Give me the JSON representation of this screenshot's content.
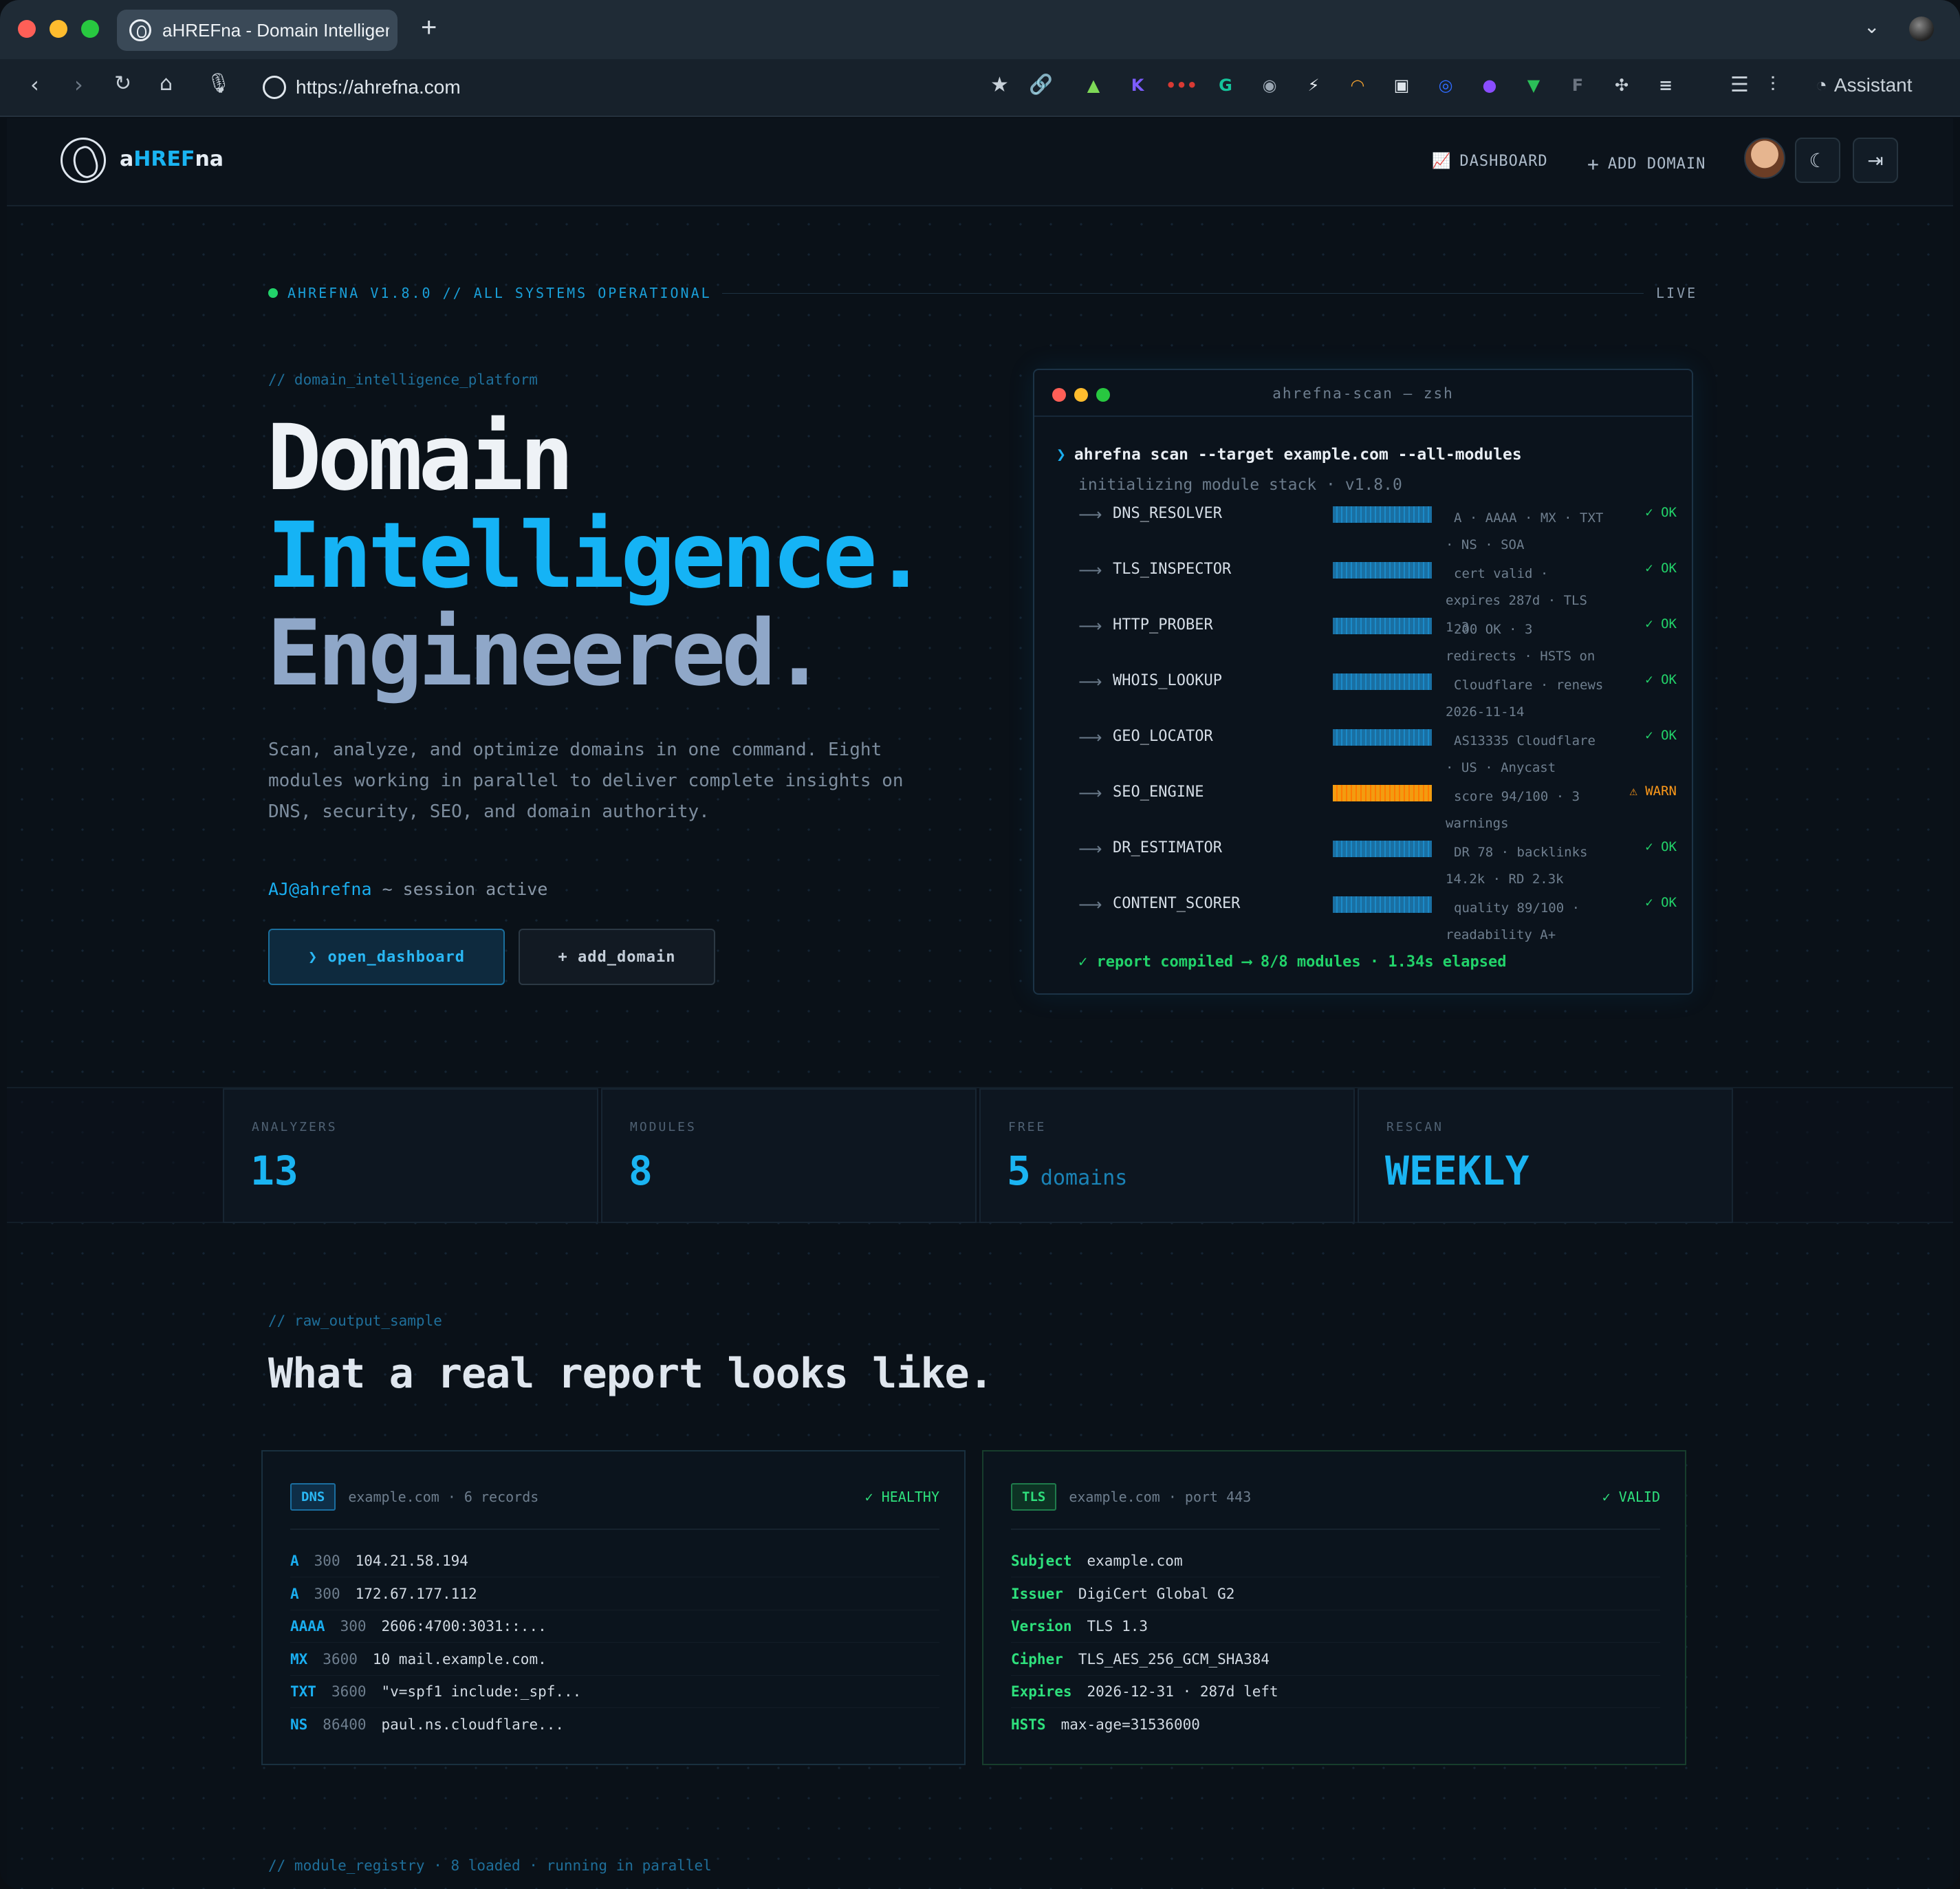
{
  "browser": {
    "tab_title": "aHREFna - Domain Intelligence",
    "new_tab": "+",
    "url": "https://ahrefna.com",
    "assistant_label": "Assistant",
    "extensions": [
      {
        "name": "rocket-icon",
        "glyph": "▲",
        "color": "#7ed957"
      },
      {
        "name": "k-extension-icon",
        "glyph": "K",
        "color": "#7c5cff"
      },
      {
        "name": "password-manager-icon",
        "glyph": "•••",
        "color": "#d83a34"
      },
      {
        "name": "grammarly-icon",
        "glyph": "G",
        "color": "#15c39a"
      },
      {
        "name": "camera-icon",
        "glyph": "◉",
        "color": "#9aa6b2"
      },
      {
        "name": "bolt-icon",
        "glyph": "⚡",
        "color": "#e9eef3"
      },
      {
        "name": "rainbow-icon",
        "glyph": "◠",
        "color": "#f0a030"
      },
      {
        "name": "box-icon",
        "glyph": "▣",
        "color": "#dfe6ec"
      },
      {
        "name": "ai-circle-icon",
        "glyph": "◎",
        "color": "#2f6bff"
      },
      {
        "name": "record-icon",
        "glyph": "●",
        "color": "#8a4dff"
      },
      {
        "name": "download-icon",
        "glyph": "▼",
        "color": "#2bbf58"
      },
      {
        "name": "f-extension-icon",
        "glyph": "F",
        "color": "#6b7480"
      },
      {
        "name": "puzzle-icon",
        "glyph": "✣",
        "color": "#c7d0d8"
      },
      {
        "name": "playlist-icon",
        "glyph": "≡",
        "color": "#c7d0d8"
      }
    ]
  },
  "nav": {
    "logo_prefix": "a",
    "logo_accent": "HREF",
    "logo_suffix": "na",
    "dashboard": "DASHBOARD",
    "add_domain": "ADD DOMAIN"
  },
  "hero": {
    "status": "AHREFNA V1.8.0 // ALL SYSTEMS OPERATIONAL",
    "live": "LIVE",
    "kicker": "// domain_intelligence_platform",
    "line1": "Domain",
    "line2": "Intelligence.",
    "line3": "Engineered.",
    "description": "Scan, analyze, and optimize domains in one command. Eight modules working in parallel to deliver complete insights on DNS, security, SEO, and domain authority.",
    "session_user": "AJ@ahrefna",
    "session_rest": " ~ session active",
    "primary_btn": "❯ open_dashboard",
    "secondary_btn": "+ add_domain"
  },
  "terminal": {
    "title": "ahrefna-scan — zsh",
    "command": "ahrefna scan --target example.com --all-modules",
    "init": "initializing module stack · v1.8.0",
    "modules": [
      {
        "name": "DNS_RESOLVER",
        "detail": "A · AAAA · MX · TXT · NS · SOA",
        "status": "✓ OK",
        "warn": false
      },
      {
        "name": "TLS_INSPECTOR",
        "detail": "cert valid · expires 287d · TLS 1.3",
        "status": "✓ OK",
        "warn": false
      },
      {
        "name": "HTTP_PROBER",
        "detail": "200 OK · 3 redirects · HSTS on",
        "status": "✓ OK",
        "warn": false
      },
      {
        "name": "WHOIS_LOOKUP",
        "detail": "Cloudflare · renews 2026-11-14",
        "status": "✓ OK",
        "warn": false
      },
      {
        "name": "GEO_LOCATOR",
        "detail": "AS13335 Cloudflare · US · Anycast",
        "status": "✓ OK",
        "warn": false
      },
      {
        "name": "SEO_ENGINE",
        "detail": "score 94/100 · 3 warnings",
        "status": "⚠ WARN",
        "warn": true
      },
      {
        "name": "DR_ESTIMATOR",
        "detail": "DR 78 · backlinks 14.2k · RD 2.3k",
        "status": "✓ OK",
        "warn": false
      },
      {
        "name": "CONTENT_SCORER",
        "detail": "quality 89/100 · readability A+",
        "status": "✓ OK",
        "warn": false
      }
    ],
    "footer": "✓ report compiled ⟶ 8/8 modules · 1.34s elapsed"
  },
  "stats": [
    {
      "label": "ANALYZERS",
      "value": "13",
      "unit": ""
    },
    {
      "label": "MODULES",
      "value": "8",
      "unit": ""
    },
    {
      "label": "FREE",
      "value": "5",
      "unit": "domains"
    },
    {
      "label": "RESCAN",
      "value": "WEEKLY",
      "unit": ""
    }
  ],
  "report": {
    "kicker": "// raw_output_sample",
    "heading": "What a real report looks like.",
    "dns": {
      "chip": "DNS",
      "meta": "example.com · 6 records",
      "status": "✓ HEALTHY",
      "records": [
        {
          "type": "A",
          "ttl": "300",
          "value": "104.21.58.194"
        },
        {
          "type": "A",
          "ttl": "300",
          "value": "172.67.177.112"
        },
        {
          "type": "AAAA",
          "ttl": "300",
          "value": "2606:4700:3031::..."
        },
        {
          "type": "MX",
          "ttl": "3600",
          "value": "10 mail.example.com."
        },
        {
          "type": "TXT",
          "ttl": "3600",
          "value": "\"v=spf1 include:_spf..."
        },
        {
          "type": "NS",
          "ttl": "86400",
          "value": "paul.ns.cloudflare..."
        }
      ]
    },
    "tls": {
      "chip": "TLS",
      "meta": "example.com · port 443",
      "status": "✓ VALID",
      "fields": [
        {
          "key": "Subject",
          "value": "example.com"
        },
        {
          "key": "Issuer",
          "value": "DigiCert Global G2"
        },
        {
          "key": "Version",
          "value": "TLS 1.3"
        },
        {
          "key": "Cipher",
          "value": "TLS_AES_256_GCM_SHA384"
        },
        {
          "key": "Expires",
          "value": "2026-12-31 · 287d left"
        },
        {
          "key": "HSTS",
          "value": "max-age=31536000"
        }
      ]
    }
  },
  "registry": {
    "kicker": "// module_registry · 8 loaded · running in parallel"
  }
}
